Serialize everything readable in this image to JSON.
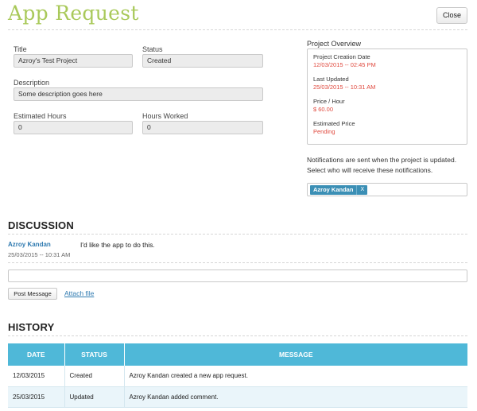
{
  "page": {
    "title": "App Request",
    "close_label": "Close"
  },
  "form": {
    "title_label": "Title",
    "title_value": "Azroy's Test Project",
    "status_label": "Status",
    "status_value": "Created",
    "description_label": "Description",
    "description_value": "Some description goes here",
    "estimated_hours_label": "Estimated Hours",
    "estimated_hours_value": "0",
    "hours_worked_label": "Hours Worked",
    "hours_worked_value": "0"
  },
  "overview": {
    "heading": "Project Overview",
    "creation_label": "Project Creation Date",
    "creation_value": "12/03/2015 -- 02:45 PM",
    "updated_label": "Last Updated",
    "updated_value": "25/03/2015 -- 10:31 AM",
    "rate_label": "Price / Hour",
    "rate_value": "$ 60.00",
    "estimate_label": "Estimated Price",
    "estimate_value": "Pending",
    "value_color": "#e04a3f"
  },
  "notifications": {
    "line1": "Notifications are sent when the project is updated.",
    "line2": "Select who will receive these notifications.",
    "recipients": [
      "Azroy Kandan"
    ],
    "remove_symbol": "X"
  },
  "discussion": {
    "heading": "DISCUSSION",
    "messages": [
      {
        "author": "Azroy Kandan",
        "time": "25/03/2015 -- 10:31 AM",
        "text": "I'd like the app to do this."
      }
    ],
    "message_value": "",
    "post_label": "Post Message",
    "attach_label": "Attach file"
  },
  "history": {
    "heading": "HISTORY",
    "columns": [
      "DATE",
      "STATUS",
      "MESSAGE"
    ],
    "rows": [
      [
        "12/03/2015",
        "Created",
        "Azroy Kandan created a new app request."
      ],
      [
        "25/03/2015",
        "Updated",
        "Azroy Kandan added comment."
      ]
    ],
    "header_color": "#4fb8d8"
  },
  "colors": {
    "title": "#a9c95a",
    "link": "#2f7ab0",
    "tag": "#3b8fb5"
  }
}
